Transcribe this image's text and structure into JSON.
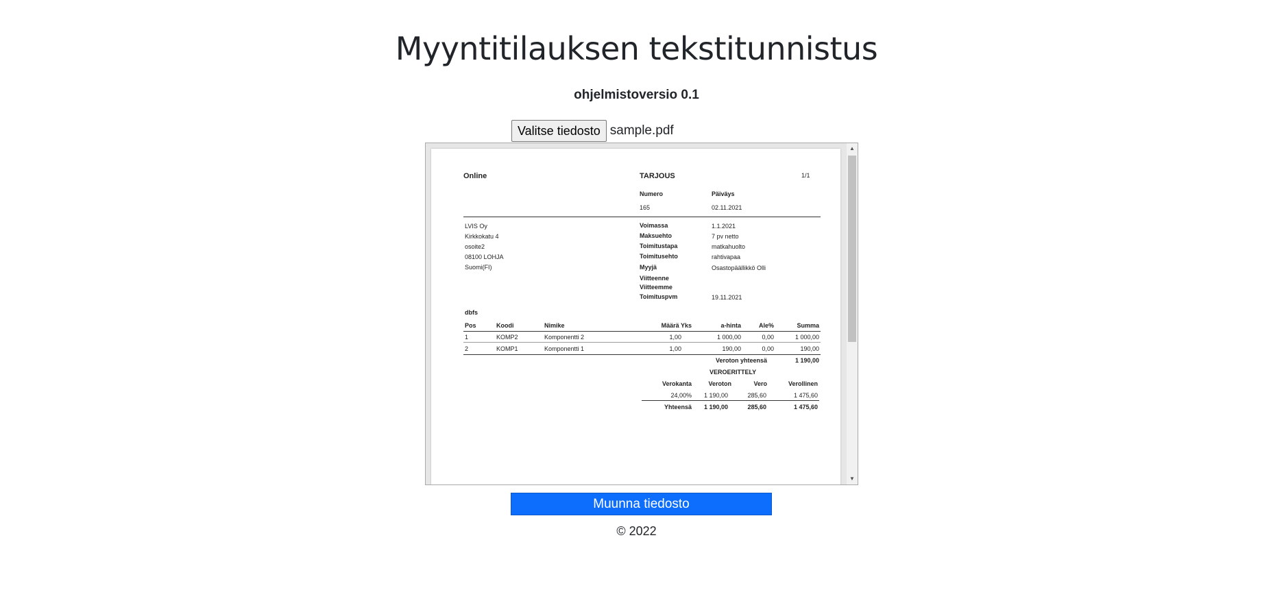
{
  "header": {
    "title": "Myyntitilauksen tekstitunnistus",
    "version": "ohjelmistoversio 0.1"
  },
  "file_input": {
    "button_label": "Valitse tiedosto",
    "file_name": "sample.pdf"
  },
  "document": {
    "company": "Online",
    "doc_type": "TARJOUS",
    "page": "1/1",
    "numero_label": "Numero",
    "numero": "165",
    "paivays_label": "Päiväys",
    "paivays": "02.11.2021",
    "customer": [
      "LVIS Oy",
      "Kirkkokatu 4",
      "osoite2",
      "08100  LOHJA",
      "Suomi(FI)"
    ],
    "details": [
      {
        "label": "Voimassa",
        "value": "1.1.2021"
      },
      {
        "label": "Maksuehto",
        "value": "7 pv netto"
      },
      {
        "label": "Toimitustapa",
        "value": "matkahuolto"
      },
      {
        "label": "Toimitusehto",
        "value": "rahtivapaa"
      },
      {
        "label": "Myyjä",
        "value": "Osastopäällikkö Olli"
      },
      {
        "label": "Viitteenne",
        "value": ""
      },
      {
        "label": "Viitteemme",
        "value": ""
      },
      {
        "label": "Toimituspvm",
        "value": "19.11.2021"
      }
    ],
    "section": "dbfs",
    "table_headers": {
      "pos": "Pos",
      "koodi": "Koodi",
      "nimike": "Nimike",
      "maara": "Määrä Yks",
      "ahinta": "a-hinta",
      "ale": "Ale%",
      "summa": "Summa"
    },
    "rows": [
      {
        "pos": "1",
        "koodi": "KOMP2",
        "nimike": "Komponentti 2",
        "maara": "1,00",
        "ahinta": "1 000,00",
        "ale": "0,00",
        "summa": "1 000,00"
      },
      {
        "pos": "2",
        "koodi": "KOMP1",
        "nimike": "Komponentti 1",
        "maara": "1,00",
        "ahinta": "190,00",
        "ale": "0,00",
        "summa": "190,00"
      }
    ],
    "veroton_label": "Veroton yhteensä",
    "veroton_value": "1 190,00",
    "tax_title": "VEROERITTELY",
    "tax_headers": {
      "verokanta": "Verokanta",
      "veroton": "Veroton",
      "vero": "Vero",
      "verollinen": "Verollinen"
    },
    "tax_row": {
      "verokanta": "24,00%",
      "veroton": "1 190,00",
      "vero": "285,60",
      "verollinen": "1 475,60"
    },
    "tax_total": {
      "label": "Yhteensä",
      "veroton": "1 190,00",
      "vero": "285,60",
      "verollinen": "1 475,60"
    }
  },
  "actions": {
    "convert_label": "Muunna tiedosto"
  },
  "footer": {
    "copyright": "© 2022"
  }
}
